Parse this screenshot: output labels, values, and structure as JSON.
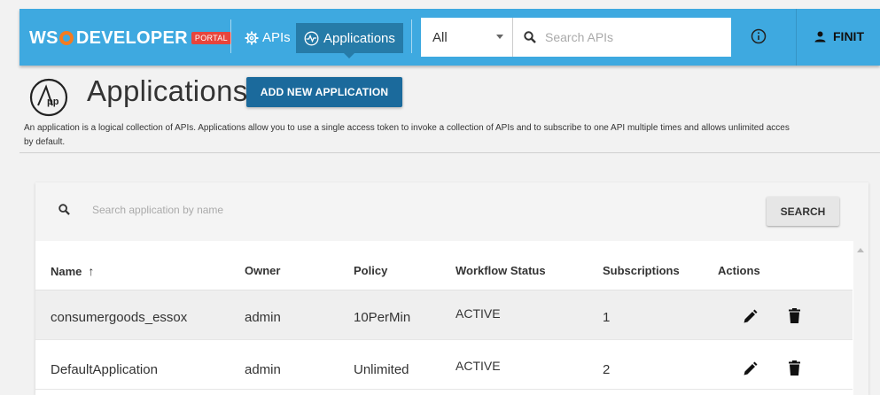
{
  "header": {
    "logo_ws": "WS",
    "logo_developer": "DEVELOPER",
    "logo_portal": "PORTAL",
    "nav": [
      {
        "label": "APIs",
        "icon": "gear-icon"
      },
      {
        "label": "Applications",
        "icon": "activity-icon",
        "active": true
      }
    ],
    "filter_value": "All",
    "search_placeholder": "Search APIs",
    "user_name": "FINIT"
  },
  "page": {
    "title": "Applications",
    "app_logo_text": "App",
    "add_button": "ADD NEW APPLICATION",
    "description_line1": "An application is a logical collection of APIs. Applications allow you to use a single access token to invoke a collection of APIs and to subscribe to one API multiple times and allows unlimited acces",
    "description_line2": "by default."
  },
  "table": {
    "search_placeholder": "Search application by name",
    "search_button": "SEARCH",
    "columns": [
      "Name",
      "Owner",
      "Policy",
      "Workflow Status",
      "Subscriptions",
      "Actions"
    ],
    "sort_icon": "↑",
    "rows": [
      {
        "name": "consumergoods_essox",
        "owner": "admin",
        "policy": "10PerMin",
        "status": "ACTIVE",
        "subscriptions": "1"
      },
      {
        "name": "DefaultApplication",
        "owner": "admin",
        "policy": "Unlimited",
        "status": "ACTIVE",
        "subscriptions": "2"
      }
    ]
  },
  "colors": {
    "topbar": "#3ea9e0",
    "nav_active": "#267ba8",
    "primary_button": "#1b6a9c",
    "portal_badge": "#e8453c"
  }
}
